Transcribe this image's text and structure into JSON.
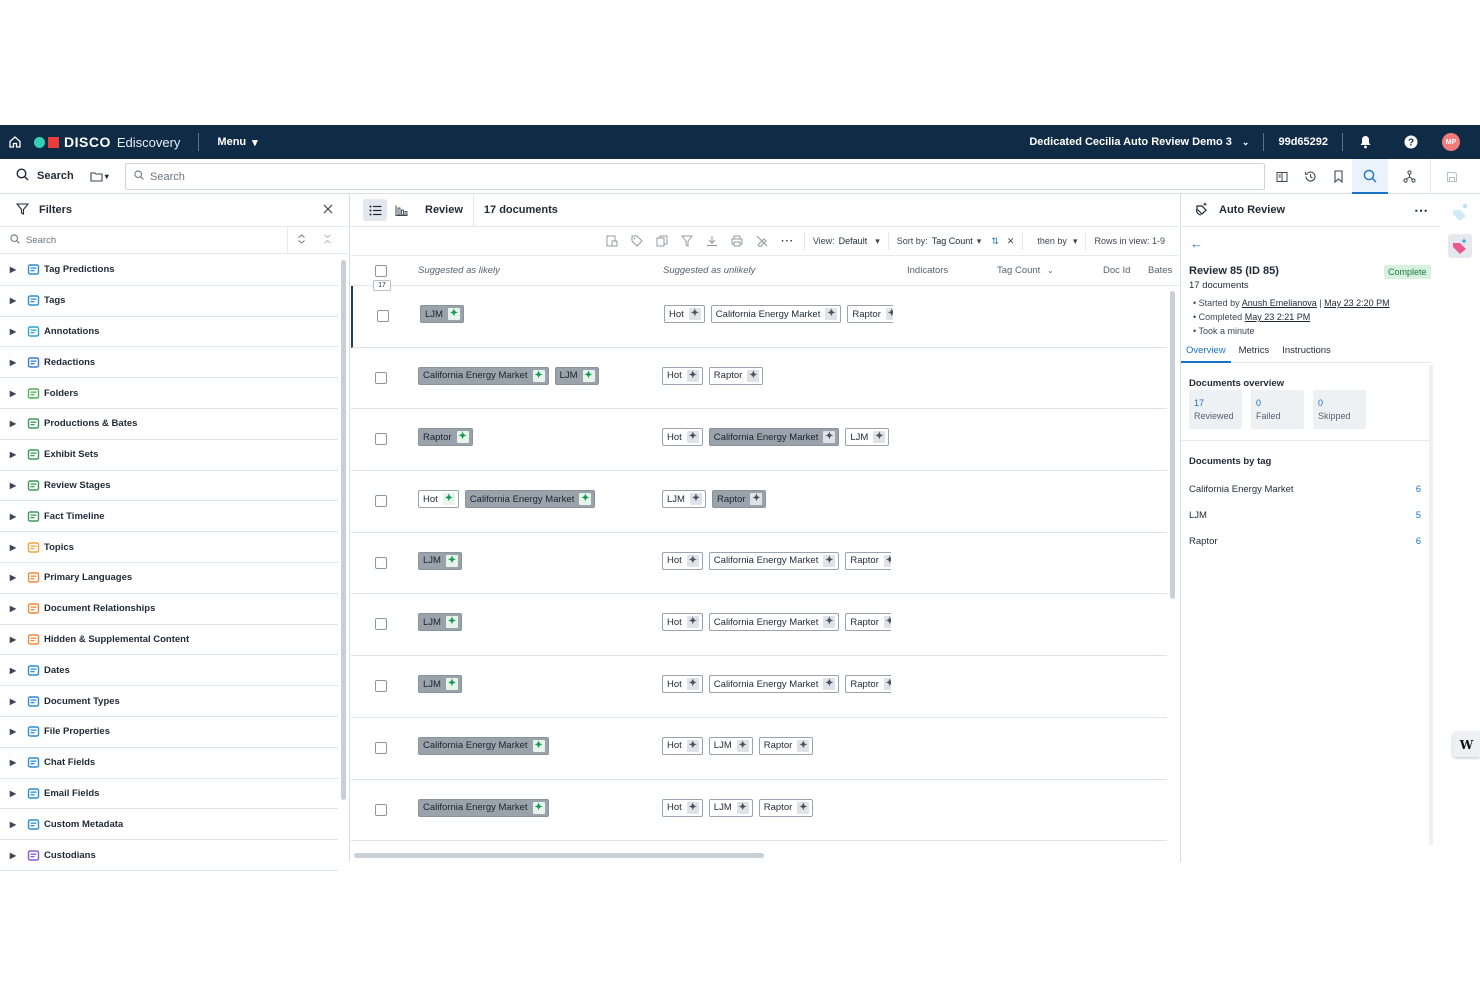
{
  "topbar": {
    "brand": "DISCO",
    "product": "Ediscovery",
    "menu_label": "Menu",
    "project": "Dedicated Cecilia Auto Review Demo 3",
    "matter_id": "99d65292",
    "avatar_initials": "MP"
  },
  "searchbar": {
    "search_label": "Search",
    "placeholder": "Search"
  },
  "filters": {
    "title": "Filters",
    "search_placeholder": "Search",
    "items": [
      {
        "label": "Tag Predictions",
        "icon": "tag-predictions-icon",
        "color": "#2a8fd6"
      },
      {
        "label": "Tags",
        "icon": "tag-icon",
        "color": "#2a8fd6"
      },
      {
        "label": "Annotations",
        "icon": "annotation-icon",
        "color": "#2aa6c8"
      },
      {
        "label": "Redactions",
        "icon": "redaction-icon",
        "color": "#3a7bd5"
      },
      {
        "label": "Folders",
        "icon": "folder-icon",
        "color": "#4caf50"
      },
      {
        "label": "Productions & Bates",
        "icon": "productions-icon",
        "color": "#3a9a5a"
      },
      {
        "label": "Exhibit Sets",
        "icon": "exhibit-icon",
        "color": "#3a9a5a"
      },
      {
        "label": "Review Stages",
        "icon": "review-stages-icon",
        "color": "#3a9a5a"
      },
      {
        "label": "Fact Timeline",
        "icon": "timeline-icon",
        "color": "#3a9a5a"
      },
      {
        "label": "Topics",
        "icon": "lightbulb-icon",
        "color": "#f2a33a"
      },
      {
        "label": "Primary Languages",
        "icon": "language-icon",
        "color": "#f08a3a"
      },
      {
        "label": "Document Relationships",
        "icon": "relationships-icon",
        "color": "#f08a3a"
      },
      {
        "label": "Hidden & Supplemental Content",
        "icon": "hidden-content-icon",
        "color": "#f08a3a"
      },
      {
        "label": "Dates",
        "icon": "calendar-icon",
        "color": "#2a8fd6"
      },
      {
        "label": "Document Types",
        "icon": "document-icon",
        "color": "#2a8fd6"
      },
      {
        "label": "File Properties",
        "icon": "file-properties-icon",
        "color": "#2a8fd6"
      },
      {
        "label": "Chat Fields",
        "icon": "chat-icon",
        "color": "#2a8fd6"
      },
      {
        "label": "Email Fields",
        "icon": "at-icon",
        "color": "#2a8fd6"
      },
      {
        "label": "Custom Metadata",
        "icon": "database-icon",
        "color": "#2a8fd6"
      },
      {
        "label": "Custodians",
        "icon": "custodians-icon",
        "color": "#8a5ad6"
      }
    ]
  },
  "review": {
    "title": "Review",
    "doc_count": "17 documents",
    "view_label": "View:",
    "view_value": "Default",
    "sort_label": "Sort by:",
    "sort_value": "Tag Count",
    "then_by": "then by",
    "rows_in_view": "Rows in view: 1-9",
    "selected_count": "17",
    "columns": {
      "likely": "Suggested as likely",
      "unlikely": "Suggested as unlikely",
      "indicators": "Indicators",
      "tag_count": "Tag Count",
      "doc_id": "Doc Id",
      "bates": "Bates"
    },
    "rows": [
      {
        "likely": [
          {
            "t": "LJM",
            "dark": true
          }
        ],
        "unlikely": [
          {
            "t": "Hot"
          },
          {
            "t": "California Energy Market"
          },
          {
            "t": "Raptor"
          }
        ]
      },
      {
        "likely": [
          {
            "t": "California Energy Market",
            "dark": true
          },
          {
            "t": "LJM",
            "dark": true
          }
        ],
        "unlikely": [
          {
            "t": "Hot"
          },
          {
            "t": "Raptor"
          }
        ]
      },
      {
        "likely": [
          {
            "t": "Raptor",
            "dark": true
          }
        ],
        "unlikely": [
          {
            "t": "Hot"
          },
          {
            "t": "California Energy Market",
            "dark": true
          },
          {
            "t": "LJM"
          }
        ]
      },
      {
        "likely": [
          {
            "t": "Hot"
          },
          {
            "t": "California Energy Market",
            "dark": true
          }
        ],
        "unlikely": [
          {
            "t": "LJM"
          },
          {
            "t": "Raptor",
            "dark": true
          }
        ]
      },
      {
        "likely": [
          {
            "t": "LJM",
            "dark": true
          }
        ],
        "unlikely": [
          {
            "t": "Hot"
          },
          {
            "t": "California Energy Market"
          },
          {
            "t": "Raptor"
          }
        ]
      },
      {
        "likely": [
          {
            "t": "LJM",
            "dark": true
          }
        ],
        "unlikely": [
          {
            "t": "Hot"
          },
          {
            "t": "California Energy Market"
          },
          {
            "t": "Raptor"
          }
        ]
      },
      {
        "likely": [
          {
            "t": "LJM",
            "dark": true
          }
        ],
        "unlikely": [
          {
            "t": "Hot"
          },
          {
            "t": "California Energy Market"
          },
          {
            "t": "Raptor"
          }
        ]
      },
      {
        "likely": [
          {
            "t": "California Energy Market",
            "dark": true
          }
        ],
        "unlikely": [
          {
            "t": "Hot"
          },
          {
            "t": "LJM"
          },
          {
            "t": "Raptor"
          }
        ]
      },
      {
        "likely": [
          {
            "t": "California Energy Market",
            "dark": true
          }
        ],
        "unlikely": [
          {
            "t": "Hot"
          },
          {
            "t": "LJM"
          },
          {
            "t": "Raptor"
          }
        ]
      }
    ]
  },
  "auto_review": {
    "title": "Auto Review",
    "review_title": "Review 85 (ID 85)",
    "status": "Complete",
    "doc_count": "17 documents",
    "started_prefix": "Started by",
    "started_by": "Anush Emelianova",
    "started_at": "May 23 2:20 PM",
    "completed_prefix": "Completed",
    "completed_at": "May 23 2:21 PM",
    "duration": "Took a minute",
    "tabs": [
      "Overview",
      "Metrics",
      "Instructions"
    ],
    "overview_heading": "Documents overview",
    "stats": [
      {
        "value": "17",
        "label": "Reviewed"
      },
      {
        "value": "0",
        "label": "Failed"
      },
      {
        "value": "0",
        "label": "Skipped"
      }
    ],
    "by_tag_heading": "Documents by tag",
    "by_tag": [
      {
        "tag": "California Energy Market",
        "count": "6"
      },
      {
        "tag": "LJM",
        "count": "5"
      },
      {
        "tag": "Raptor",
        "count": "6"
      }
    ]
  },
  "colors": {
    "topbar": "#0f2b46",
    "accent": "#1a73c9",
    "complete_bg": "#d7f0df"
  }
}
